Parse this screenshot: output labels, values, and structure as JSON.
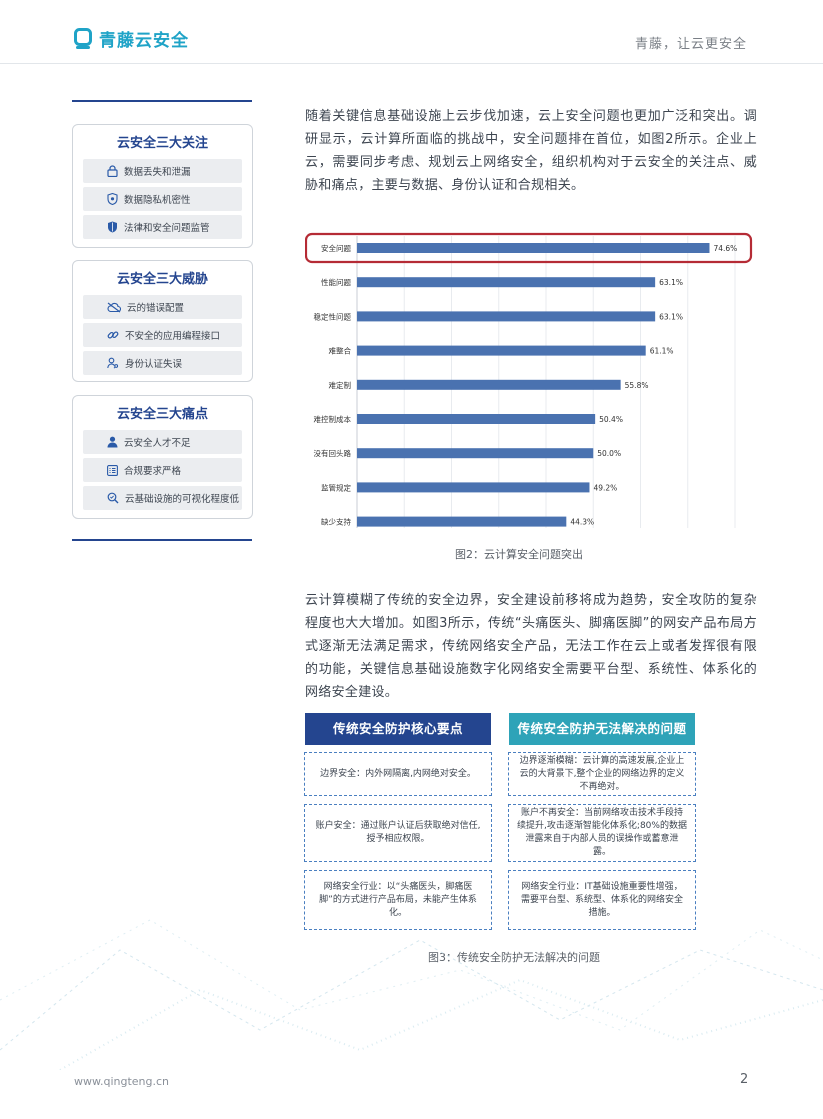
{
  "header": {
    "brand": "青藤云安全",
    "slogan": "青藤，让云更安全",
    "brand_color": "#1fa3c7"
  },
  "sidebar": {
    "cards": [
      {
        "title": "云安全三大关注",
        "items": [
          {
            "label": "数据丢失和泄漏",
            "icon": "lock-icon"
          },
          {
            "label": "数据隐私机密性",
            "icon": "shield-gear-icon"
          },
          {
            "label": "法律和安全问题监管",
            "icon": "shield-icon"
          }
        ]
      },
      {
        "title": "云安全三大威胁",
        "items": [
          {
            "label": "云的错误配置",
            "icon": "cloud-off-icon"
          },
          {
            "label": "不安全的应用编程接口",
            "icon": "link-icon"
          },
          {
            "label": "身份认证失误",
            "icon": "user-key-icon"
          }
        ]
      },
      {
        "title": "云安全三大痛点",
        "items": [
          {
            "label": "云安全人才不足",
            "icon": "user-icon"
          },
          {
            "label": "合规要求严格",
            "icon": "document-icon"
          },
          {
            "label": "云基础设施的可视化程度低",
            "icon": "search-icon"
          }
        ]
      }
    ]
  },
  "main": {
    "para1": "随着关键信息基础设施上云步伐加速，云上安全问题也更加广泛和突出。调研显示，云计算所面临的挑战中，安全问题排在首位，如图2所示。企业上云，需要同步考虑、规划云上网络安全，组织机构对于云安全的关注点、威胁和痛点，主要与数据、身份认证和合规相关。",
    "caption2": "图2：云计算安全问题突出",
    "para2": "云计算模糊了传统的安全边界，安全建设前移将成为趋势，安全攻防的复杂程度也大大增加。如图3所示，传统“头痛医头、脚痛医脚”的网安产品布局方式逐渐无法满足需求，传统网络安全产品，无法工作在云上或者发挥很有限的功能，关键信息基础设施数字化网络安全需要平台型、系统性、体系化的网络安全建设。",
    "caption3": "图3：传统安全防护无法解决的问题"
  },
  "chart_data": {
    "type": "bar",
    "orientation": "horizontal",
    "categories": [
      "安全问题",
      "性能问题",
      "稳定性问题",
      "难整合",
      "难定制",
      "难控制成本",
      "没有回头路",
      "监管规定",
      "缺少支持"
    ],
    "values": [
      74.6,
      63.1,
      63.1,
      61.1,
      55.8,
      50.4,
      50.0,
      49.2,
      44.3
    ],
    "labels": [
      "74.6%",
      "63.1%",
      "63.1%",
      "61.1%",
      "55.8%",
      "50.4%",
      "50.0%",
      "49.2%",
      "44.3%"
    ],
    "xlim": [
      0,
      80
    ],
    "bar_color": "#4a72b0",
    "highlight_color": "#b52b35",
    "highlight_index": 0
  },
  "comparison": {
    "left_header": "传统安全防护核心要点",
    "right_header": "传统安全防护无法解决的问题",
    "left_color": "#24458f",
    "right_color": "#2ea3b8",
    "left": [
      "边界安全：内外网隔离,内网绝对安全。",
      "账户安全：通过账户认证后获取绝对信任,授予相应权限。",
      "网络安全行业：以“头痛医头，脚痛医脚”的方式进行产品布局，未能产生体系化。"
    ],
    "right": [
      "边界逐渐模糊：云计算的高速发展,企业上云的大背景下,整个企业的网络边界的定义不再绝对。",
      "账户不再安全：当前网络攻击技术手段持续提升,攻击逐渐智能化体系化;80%的数据泄露来自于内部人员的误操作或蓄意泄露。",
      "网络安全行业：IT基础设施重要性增强，需要平台型、系统型、体系化的网络安全措施。"
    ]
  },
  "footer": {
    "url": "www.qingteng.cn",
    "page": "2"
  }
}
